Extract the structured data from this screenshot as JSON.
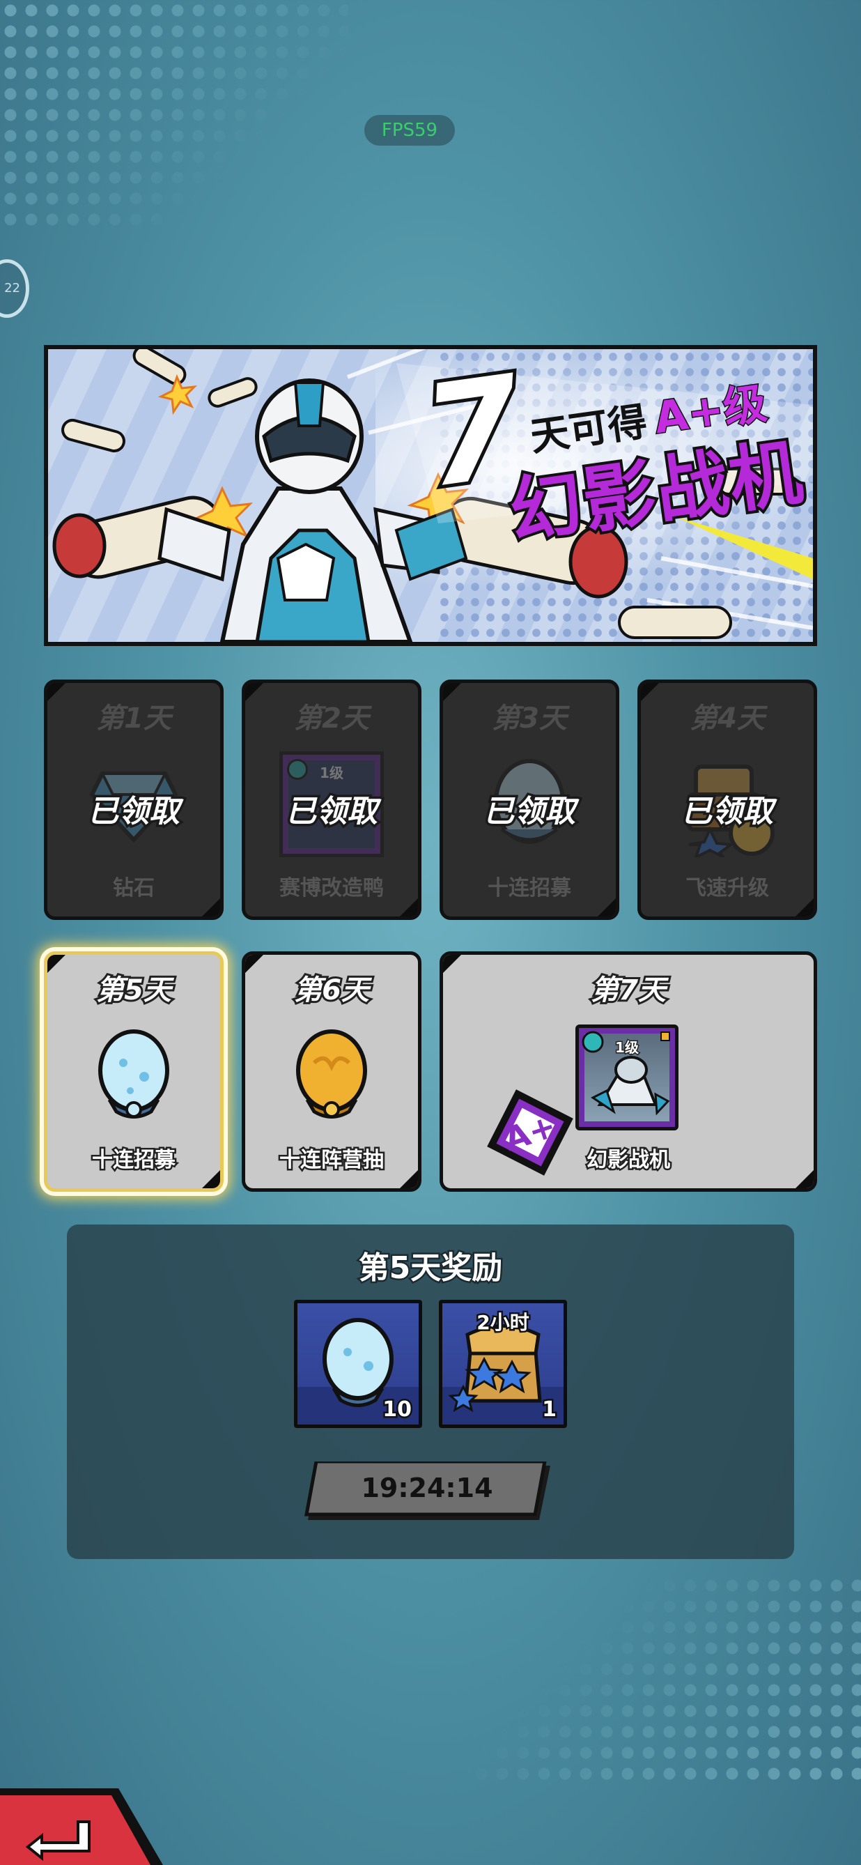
{
  "hud": {
    "fps": "FPS59",
    "side_badge": "22"
  },
  "banner": {
    "number": "7",
    "line1": "天可得",
    "grade": "A+级",
    "line2": "幻影战机"
  },
  "claimed_label": "已领取",
  "days": [
    {
      "day": "第1天",
      "name": "钻石",
      "state": "claimed",
      "icon": "diamond-icon"
    },
    {
      "day": "第2天",
      "name": "赛博改造鸭",
      "state": "claimed",
      "icon": "hero-card-icon",
      "level": "1级"
    },
    {
      "day": "第3天",
      "name": "十连招募",
      "state": "claimed",
      "icon": "egg-icon"
    },
    {
      "day": "第4天",
      "name": "飞速升级",
      "state": "claimed",
      "icon": "treasure-exp-icon"
    },
    {
      "day": "第5天",
      "name": "十连招募",
      "state": "selected",
      "icon": "blue-egg-icon"
    },
    {
      "day": "第6天",
      "name": "十连阵营抽",
      "state": "open",
      "icon": "gold-egg-icon"
    },
    {
      "day": "第7天",
      "name": "幻影战机",
      "state": "open",
      "icon": "fighter-card-icon",
      "level": "1级",
      "grade": "A+"
    }
  ],
  "reward_panel": {
    "title": "第5天奖励",
    "items": [
      {
        "icon": "blue-egg-icon",
        "count": "10"
      },
      {
        "icon": "treasure-chest-icon",
        "label": "2小时",
        "count": "1"
      }
    ],
    "timer": "19:24:14"
  },
  "colors": {
    "background": "#4f93a6",
    "card_claimed": "#2d2d2d",
    "card_open": "#c9c9c9",
    "accent_purple": "#b52ad8",
    "selected_glow": "#ffd75a",
    "back_button": "#d8333f"
  }
}
